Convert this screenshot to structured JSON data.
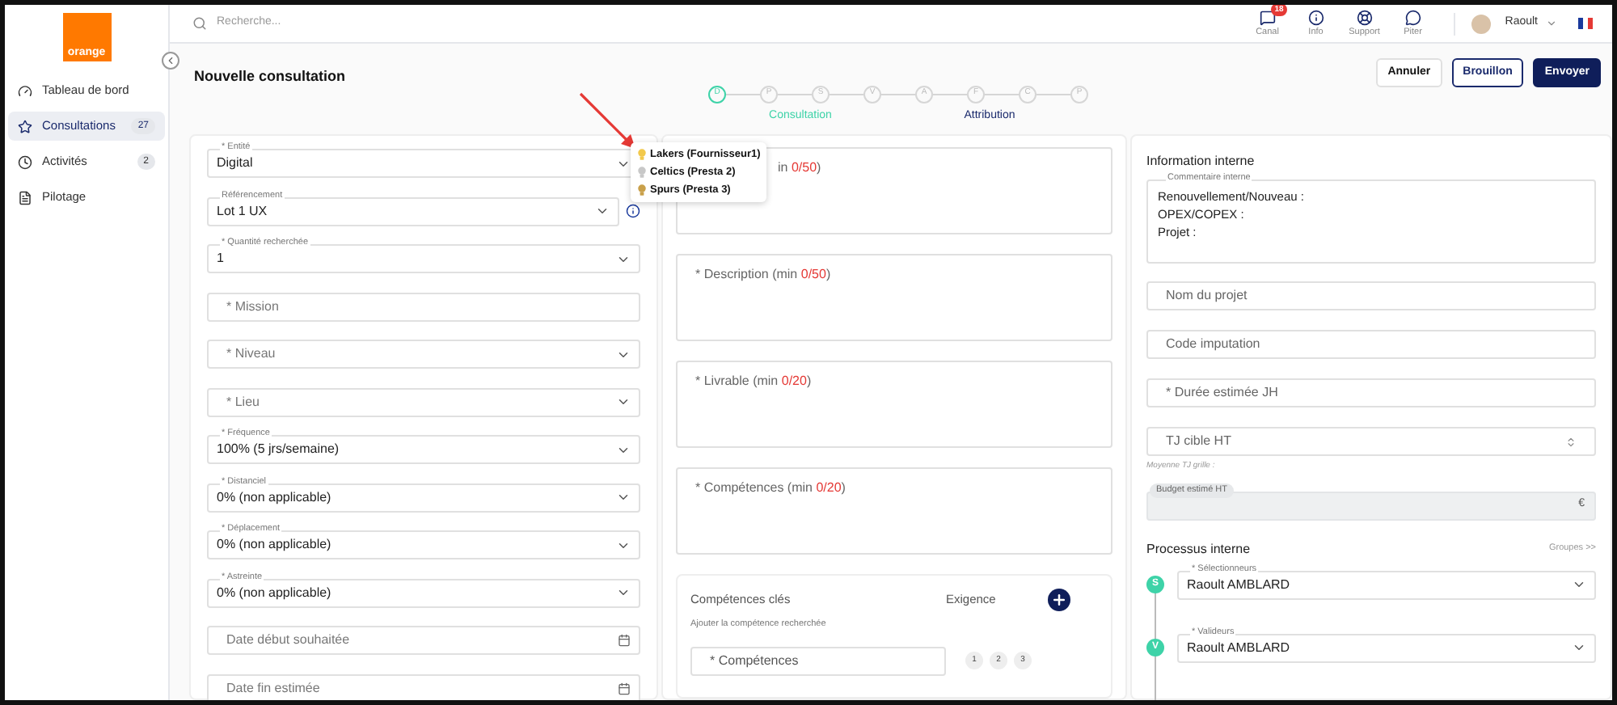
{
  "sidebar": {
    "logo": "orange",
    "items": [
      {
        "label": "Tableau de bord",
        "kind": "gauge",
        "selected": false
      },
      {
        "label": "Consultations",
        "kind": "star",
        "count": "27",
        "selected": true
      },
      {
        "label": "Activités",
        "kind": "clock",
        "count": "2",
        "selected": false
      },
      {
        "label": "Pilotage",
        "kind": "file",
        "selected": false
      }
    ]
  },
  "topbar": {
    "search_placeholder": "Recherche...",
    "actions": [
      {
        "label": "Canal",
        "kind": "chat",
        "badge": "18"
      },
      {
        "label": "Info",
        "kind": "info"
      },
      {
        "label": "Support",
        "kind": "support"
      },
      {
        "label": "Piter",
        "kind": "piter"
      }
    ],
    "user": "Raoult"
  },
  "page": {
    "title": "Nouvelle consultation",
    "buttons": [
      {
        "label": "Annuler",
        "kind": "plain"
      },
      {
        "label": "Brouillon",
        "kind": "outline"
      },
      {
        "label": "Envoyer",
        "kind": "primary"
      }
    ]
  },
  "stepper": {
    "steps": [
      {
        "letter": "D",
        "selected": true
      },
      {
        "letter": "P",
        "selected": false
      },
      {
        "letter": "S",
        "selected": false
      },
      {
        "letter": "V",
        "selected": false
      },
      {
        "letter": "A",
        "selected": false
      },
      {
        "letter": "F",
        "selected": false
      },
      {
        "letter": "C",
        "selected": false
      },
      {
        "letter": "P",
        "selected": false
      }
    ],
    "phases": [
      {
        "label": "Consultation",
        "color": "#3ed3a8"
      },
      {
        "label": "Attribution",
        "color": "#1a2a6c"
      }
    ]
  },
  "left_fields": [
    {
      "kind": "select",
      "label": "* Entité",
      "value": "Digital"
    },
    {
      "kind": "select",
      "label": "Référencement",
      "value": "Lot 1 UX",
      "info": true
    },
    {
      "kind": "select",
      "label": "* Quantité recherchée",
      "value": "1"
    },
    {
      "kind": "input",
      "placeholder": "* Mission"
    },
    {
      "kind": "select",
      "placeholder": "* Niveau"
    },
    {
      "kind": "select",
      "placeholder": "* Lieu"
    },
    {
      "kind": "select",
      "label": "* Fréquence",
      "value": "100% (5 jrs/semaine)"
    },
    {
      "kind": "select",
      "label": "* Distanciel",
      "value": "0% (non applicable)"
    },
    {
      "kind": "select",
      "label": "* Déplacement",
      "value": "0% (non applicable)"
    },
    {
      "kind": "select",
      "label": "* Astreinte",
      "value": "0% (non applicable)"
    },
    {
      "kind": "date",
      "placeholder": "Date début souhaitée"
    },
    {
      "kind": "date",
      "placeholder": "Date fin estimée"
    }
  ],
  "tooltip": {
    "items": [
      {
        "label": "Lakers (Fournisseur1)",
        "color": "#f2c94c"
      },
      {
        "label": "Celtics (Presta 2)",
        "color": "#c8c8c8"
      },
      {
        "label": "Spurs (Presta 3)",
        "color": "#c9a04a"
      }
    ]
  },
  "text_areas": [
    {
      "label": "in",
      "count": "0/50",
      "suffix": ")"
    },
    {
      "label": "* Description (min",
      "count": "0/50",
      "suffix": ")"
    },
    {
      "label": "* Livrable (min",
      "count": "0/20",
      "suffix": ")"
    },
    {
      "label": "* Compétences (min",
      "count": "0/20",
      "suffix": ")"
    }
  ],
  "skills": {
    "title": "Compétences clés",
    "requirement": "Exigence",
    "hint": "Ajouter la compétence recherchée",
    "rows": [
      {
        "placeholder": "* Compétences",
        "levels": [
          "1",
          "2",
          "3"
        ]
      }
    ]
  },
  "internal": {
    "title": "Information interne",
    "comment": {
      "label": "Commentaire interne",
      "value": "Renouvellement/Nouveau :\nOPEX/COPEX :\nProjet :"
    },
    "fields": [
      {
        "kind": "input",
        "placeholder": "Nom du projet"
      },
      {
        "kind": "input",
        "placeholder": "Code imputation"
      },
      {
        "kind": "input",
        "placeholder": "* Durée estimée JH"
      },
      {
        "kind": "number",
        "placeholder": "TJ cible HT",
        "hint": "Moyenne TJ grille :"
      },
      {
        "kind": "currency",
        "label": "Budget estimé HT",
        "suffix": "€",
        "disabled": true
      }
    ]
  },
  "process": {
    "title": "Processus interne",
    "link": "Groupes >>",
    "steps": [
      {
        "letter": "S",
        "label": "* Sélectionneurs",
        "value": "Raoult AMBLARD"
      },
      {
        "letter": "V",
        "label": "* Valideurs",
        "value": "Raoult AMBLARD"
      }
    ]
  }
}
